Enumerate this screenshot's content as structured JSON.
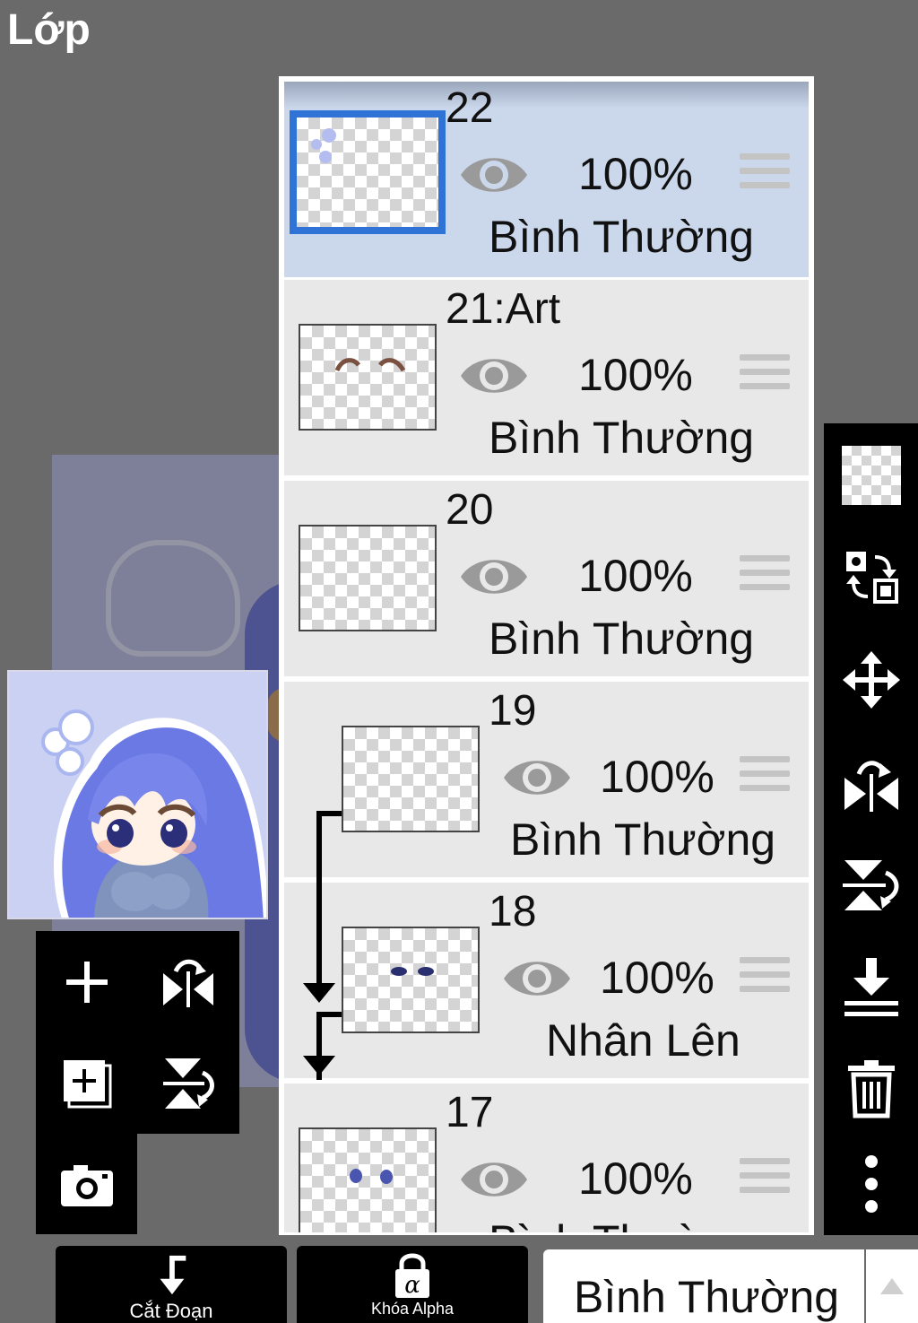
{
  "screen": {
    "title": "Lớp"
  },
  "layers": [
    {
      "name": "22",
      "opacity": "100%",
      "blend": "Bình Thường",
      "selected": true
    },
    {
      "name": "21:Art",
      "opacity": "100%",
      "blend": "Bình Thường"
    },
    {
      "name": "20",
      "opacity": "100%",
      "blend": "Bình Thường"
    },
    {
      "name": "19",
      "opacity": "100%",
      "blend": "Bình Thường",
      "clipped": true
    },
    {
      "name": "18",
      "opacity": "100%",
      "blend": "Nhân Lên",
      "clipped": true
    },
    {
      "name": "17",
      "opacity": "100%",
      "blend": "Bình Thường"
    }
  ],
  "left_toolbar": {
    "icons": [
      "add-layer-icon",
      "flip-horizontal-icon",
      "duplicate-layer-icon",
      "flip-vertical-icon",
      "camera-icon"
    ]
  },
  "right_toolbar": {
    "icons": [
      "transparency-checker-icon",
      "swap-layers-icon",
      "move-icon",
      "flip-horizontal-icon",
      "flip-vertical-icon",
      "merge-down-icon",
      "trash-icon",
      "more-vertical-icon"
    ]
  },
  "bottom_bar": {
    "clip_label": "Cắt Đoạn",
    "alpha_lock_label": "Khóa Alpha",
    "blend_mode": "Bình Thường"
  },
  "colors": {
    "selection_blue": "#2f73d6",
    "selected_row": "#cbd8ec",
    "row": "#e8e8e8",
    "background": "#6a6a6a"
  }
}
